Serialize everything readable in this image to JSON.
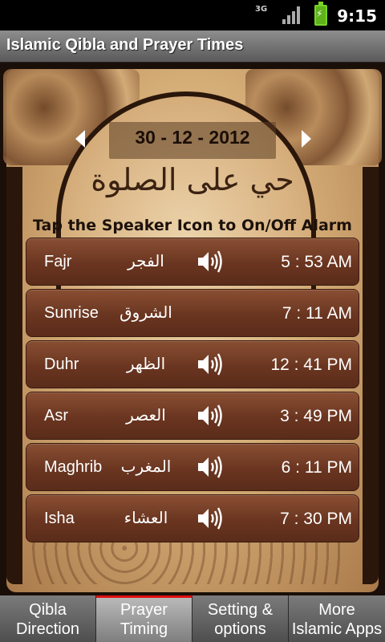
{
  "status_bar": {
    "network": "3G",
    "time": "9:15"
  },
  "app": {
    "title": "Islamic Qibla and Prayer Times"
  },
  "date": {
    "text": "30 - 12 - 2012"
  },
  "calligraphy": "حي على الصلوة",
  "instruction": "Tap the Speaker Icon to On/Off Alarm",
  "prayers": [
    {
      "name": "Fajr",
      "arabic": "الفجر",
      "time": "5 : 53 AM",
      "speaker": true
    },
    {
      "name": "Sunrise",
      "arabic": "الشروق",
      "time": "7 : 11 AM",
      "speaker": false
    },
    {
      "name": "Duhr",
      "arabic": "الظهر",
      "time": "12 : 41 PM",
      "speaker": true
    },
    {
      "name": "Asr",
      "arabic": "العصر",
      "time": "3 : 49 PM",
      "speaker": true
    },
    {
      "name": "Maghrib",
      "arabic": "المغرب",
      "time": "6 : 11 PM",
      "speaker": true
    },
    {
      "name": "Isha",
      "arabic": "العشاء",
      "time": "7 : 30 PM",
      "speaker": true
    }
  ],
  "tabs": [
    {
      "line1": "Qibla",
      "line2": "Direction",
      "active": false
    },
    {
      "line1": "Prayer",
      "line2": "Timing",
      "active": true
    },
    {
      "line1": "Setting &",
      "line2": "options",
      "active": false
    },
    {
      "line1": "More",
      "line2": "Islamic Apps",
      "active": false
    }
  ],
  "icons": {
    "speaker": "speaker-icon",
    "prev": "arrow-left-icon",
    "next": "arrow-right-icon"
  },
  "colors": {
    "row": "#6a3520",
    "tab_indicator": "#dd1111",
    "text": "#ffffff"
  }
}
